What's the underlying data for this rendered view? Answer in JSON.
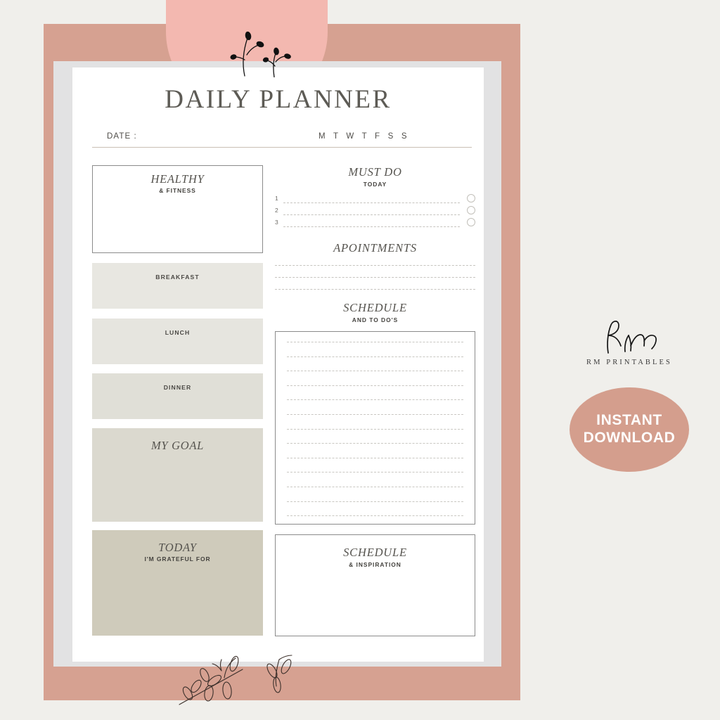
{
  "mockup": {
    "background_color": "#f0efeb",
    "rose_band_color": "#d6a191",
    "pink_arch_color": "#f3b8b0",
    "mat_color": "#e2e2e3",
    "paper_color": "#ffffff"
  },
  "planner": {
    "title": "DAILY PLANNER",
    "date_label": "DATE :",
    "weekdays": "M T W T F S S",
    "left_column": {
      "healthy": {
        "heading": "HEALTHY",
        "sub": "& FITNESS"
      },
      "breakfast": {
        "label": "BREAKFAST"
      },
      "lunch": {
        "label": "LUNCH"
      },
      "dinner": {
        "label": "DINNER"
      },
      "goal": {
        "heading": "MY GOAL"
      },
      "today": {
        "heading": "TODAY",
        "sub": "I'M GRATEFUL FOR"
      }
    },
    "right_column": {
      "must_do": {
        "heading": "MUST DO",
        "sub": "TODAY",
        "items": [
          "1",
          "2",
          "3"
        ]
      },
      "appointments": {
        "heading": "APOINTMENTS",
        "line_count": 3
      },
      "schedule": {
        "heading": "SCHEDULE",
        "sub": "AND TO DO'S",
        "line_count": 13
      },
      "inspiration": {
        "heading": "SCHEDULE",
        "sub": "& INSPIRATION"
      }
    }
  },
  "brand": {
    "logo_mark": "Rm",
    "name": "RM PRINTABLES",
    "badge": {
      "line1": "INSTANT",
      "line2": "DOWNLOAD",
      "color": "#d49e8d",
      "text_color": "#ffffff"
    }
  }
}
